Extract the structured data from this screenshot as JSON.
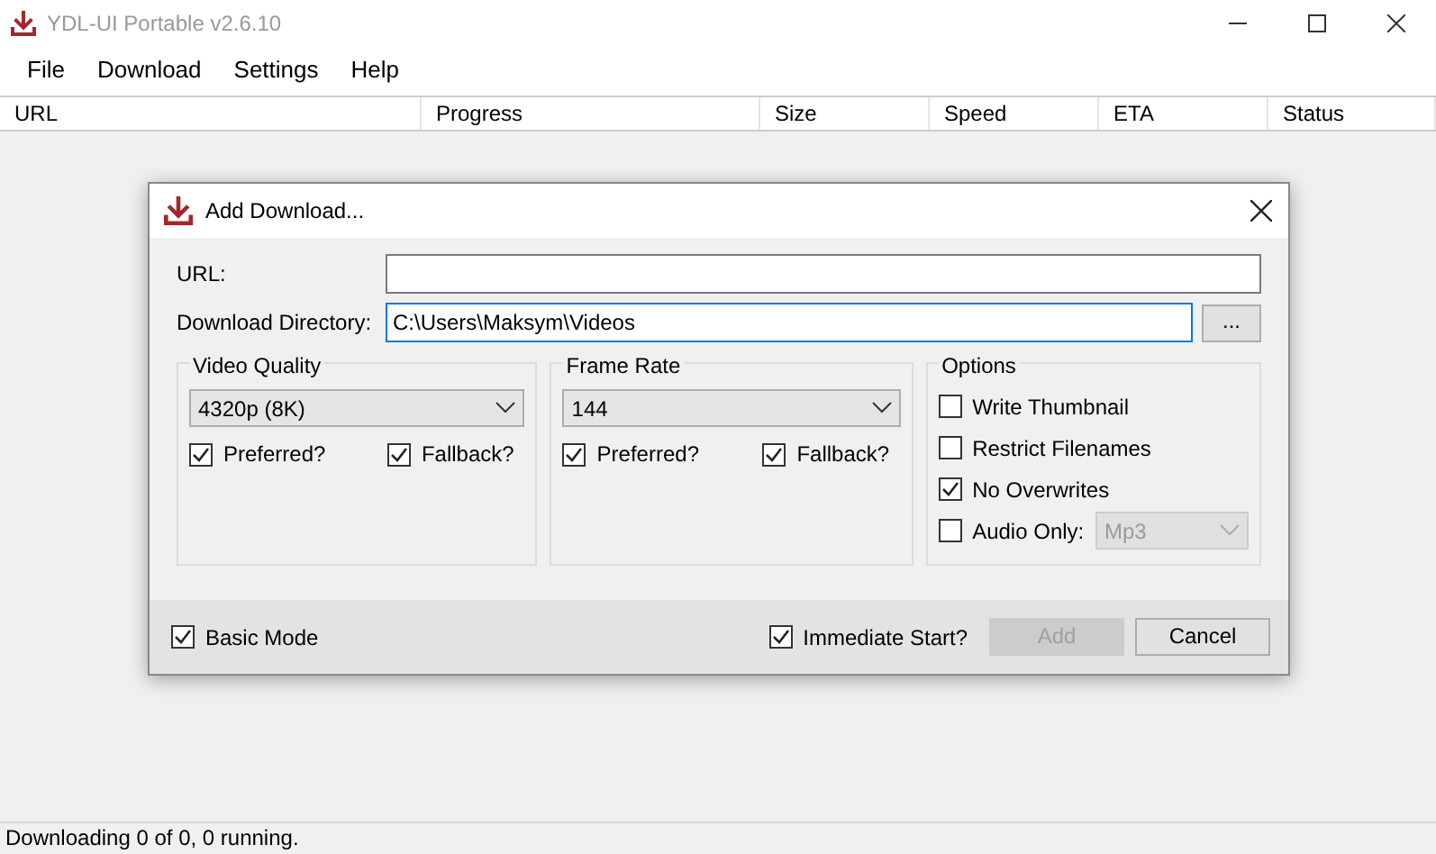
{
  "window": {
    "title": "YDL-UI Portable v2.6.10"
  },
  "menu": [
    "File",
    "Download",
    "Settings",
    "Help"
  ],
  "table": {
    "columns": [
      "URL",
      "Progress",
      "Size",
      "Speed",
      "ETA",
      "Status"
    ]
  },
  "status_bar": "Downloading 0 of 0, 0 running.",
  "dialog": {
    "title": "Add Download...",
    "url": {
      "label": "URL:"
    },
    "directory": {
      "label": "Download Directory:",
      "value": "C:\\Users\\Maksym\\Videos",
      "focused": true,
      "browse": "..."
    },
    "groups": [
      {
        "title": "Video Quality",
        "value": "4320p (8K)",
        "checks": [
          {
            "label": "Preferred?",
            "checked": true
          },
          {
            "label": "Fallback?",
            "checked": true
          }
        ]
      },
      {
        "title": "Frame Rate",
        "value": "144",
        "checks": [
          {
            "label": "Preferred?",
            "checked": true
          },
          {
            "label": "Fallback?",
            "checked": true
          }
        ]
      }
    ],
    "options": {
      "title": "Options",
      "items": [
        {
          "kind": "checkbox",
          "label": "Write Thumbnail",
          "checked": false
        },
        {
          "kind": "checkbox",
          "label": "Restrict Filenames",
          "checked": false
        },
        {
          "kind": "checkbox",
          "label": "No Overwrites",
          "checked": true
        },
        {
          "kind": "combo",
          "label": "Audio Only:",
          "checked": false,
          "value": "Mp3",
          "disabled": true
        }
      ]
    },
    "basic_mode": {
      "label": "Basic Mode",
      "checked": true
    },
    "immediate_start": {
      "label": "Immediate Start?",
      "checked": true
    },
    "buttons": [
      {
        "label": "Add",
        "disabled": true
      },
      {
        "label": "Cancel",
        "disabled": false
      }
    ]
  }
}
